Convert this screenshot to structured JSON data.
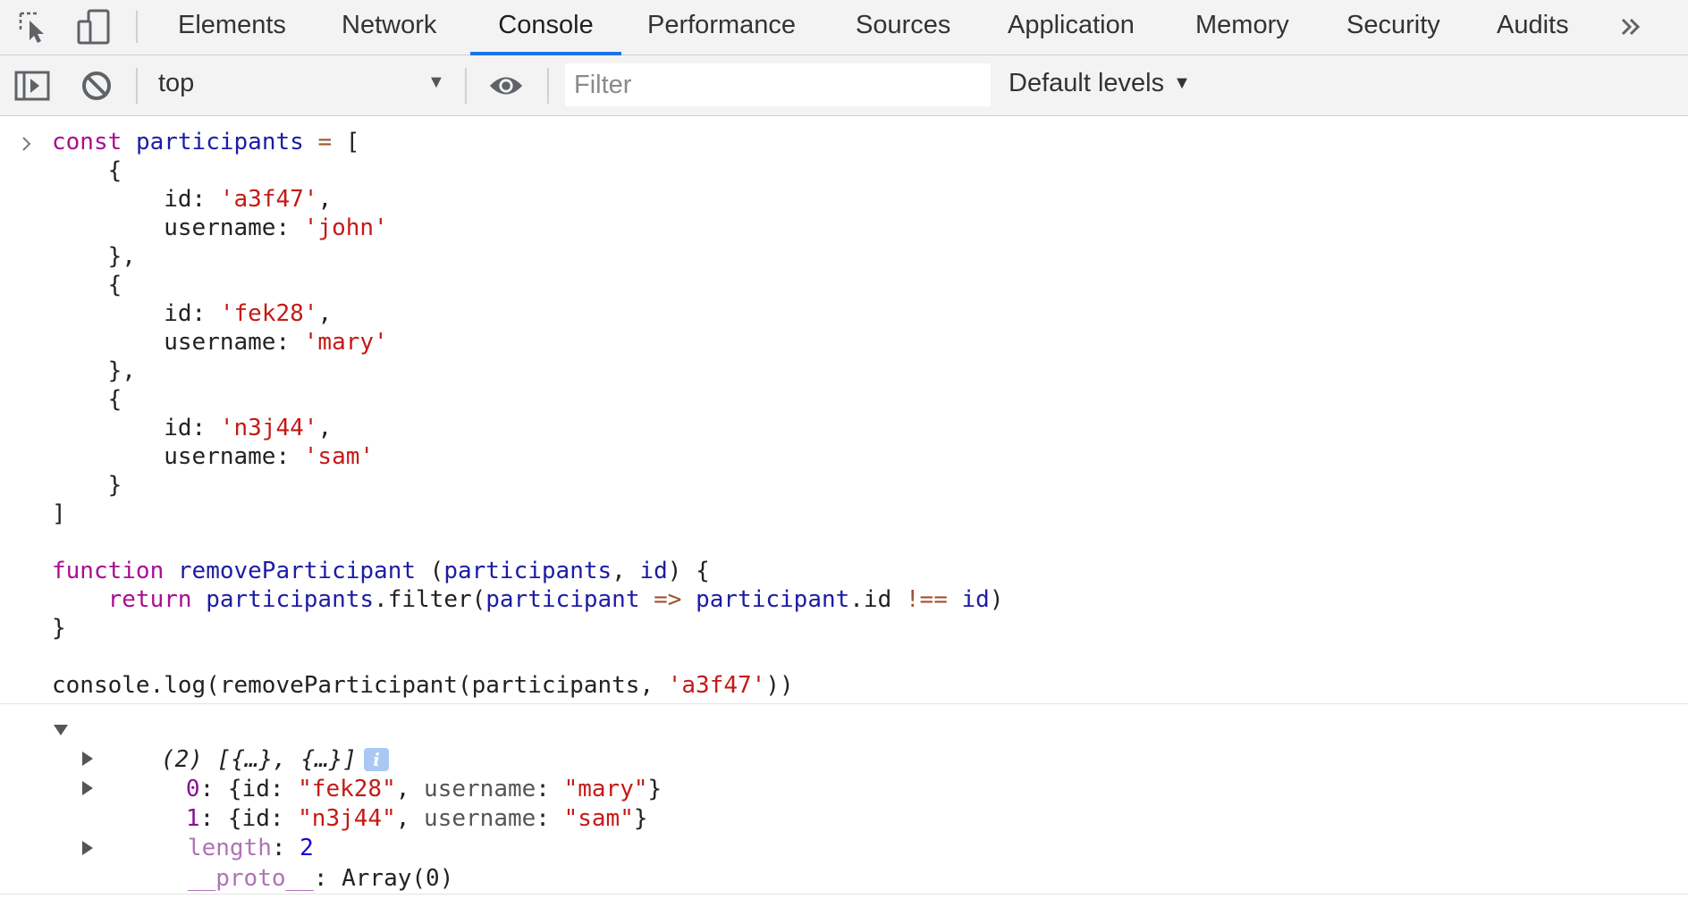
{
  "tabs": [
    {
      "label": "Elements"
    },
    {
      "label": "Network"
    },
    {
      "label": "Console"
    },
    {
      "label": "Performance"
    },
    {
      "label": "Sources"
    },
    {
      "label": "Application"
    },
    {
      "label": "Memory"
    },
    {
      "label": "Security"
    },
    {
      "label": "Audits"
    }
  ],
  "active_tab": "Console",
  "toolbar": {
    "context": "top",
    "filter_placeholder": "Filter",
    "levels": "Default levels"
  },
  "icons": {
    "inspect": "inspect-element-icon",
    "device": "device-toolbar-icon",
    "more_tabs": "more-tabs-chevron-icon",
    "sidebar": "console-sidebar-icon",
    "clear": "clear-console-icon",
    "eye": "live-expression-eye-icon",
    "prompt": "console-prompt-chevron-icon",
    "info": "info-icon"
  },
  "code": {
    "l1": {
      "a": "const",
      "b": "participants",
      "c": "=",
      "d": "["
    },
    "l2": "{",
    "l3": {
      "k": "id: ",
      "v": "'a3f47'",
      "e": ","
    },
    "l4": {
      "k": "username: ",
      "v": "'john'"
    },
    "l5": "},",
    "l6": "{",
    "l7": {
      "k": "id: ",
      "v": "'fek28'",
      "e": ","
    },
    "l8": {
      "k": "username: ",
      "v": "'mary'"
    },
    "l9": "},",
    "l10": "{",
    "l11": {
      "k": "id: ",
      "v": "'n3j44'",
      "e": ","
    },
    "l12": {
      "k": "username: ",
      "v": "'sam'"
    },
    "l13": "}",
    "l14": "]",
    "l16": {
      "a": "function",
      "b": "removeParticipant",
      "c": "(",
      "d": "participants",
      "e": ", ",
      "f": "id",
      "g": ") {"
    },
    "l17": {
      "a": "return",
      "b": "participants",
      "c": ".filter(",
      "d": "participant",
      "e": "=>",
      "f": "participant",
      "g": ".id ",
      "h": "!==",
      "i": "id",
      "j": ")"
    },
    "l18": "}",
    "l20": {
      "a": "console.log(removeParticipant(participants, ",
      "b": "'a3f47'",
      "c": "))"
    }
  },
  "output": {
    "summary": "(2) [{…}, {…}]",
    "info_glyph": "i",
    "items": [
      {
        "index": "0",
        "pre": ": {id: ",
        "id": "\"fek28\"",
        "mid": ", ",
        "ukey": "username",
        "sep": ": ",
        "uval": "\"mary\"",
        "post": "}"
      },
      {
        "index": "1",
        "pre": ": {id: ",
        "id": "\"n3j44\"",
        "mid": ", ",
        "ukey": "username",
        "sep": ": ",
        "uval": "\"sam\"",
        "post": "}"
      }
    ],
    "length_key": "length",
    "length_sep": ": ",
    "length_val": "2",
    "proto_key": "__proto__",
    "proto_val": ": Array(0)"
  }
}
